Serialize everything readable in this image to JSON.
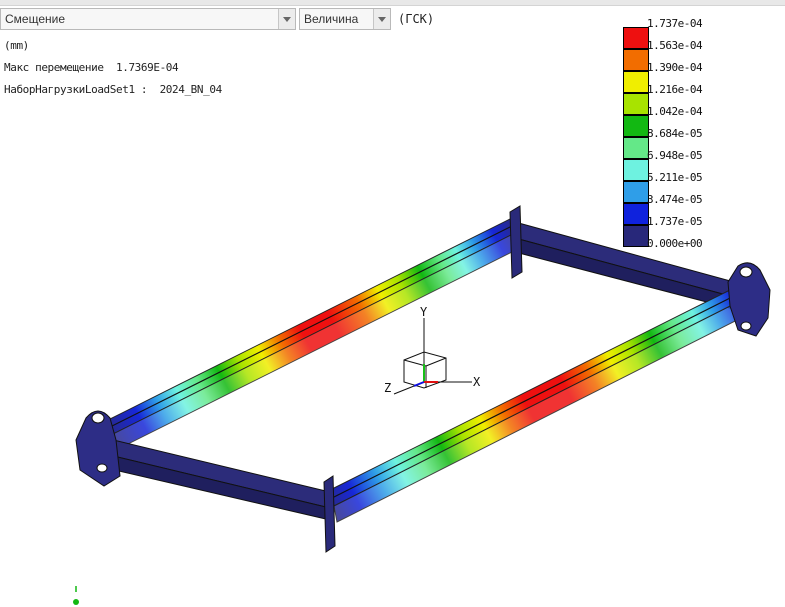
{
  "toolbar": {
    "result_type": "Смещение",
    "component": "Величина",
    "coord_system": "(ГСК)"
  },
  "info": {
    "units": "(mm)",
    "max_displacement": "Макс перемещение  1.7369E-04",
    "load_set": "НаборНагрузкиLoadSet1 :  2024_BN_04"
  },
  "legend": {
    "labels": [
      "1.737e-04",
      "1.563e-04",
      "1.390e-04",
      "1.216e-04",
      "1.042e-04",
      "8.684e-05",
      "6.948e-05",
      "5.211e-05",
      "3.474e-05",
      "1.737e-05",
      "0.000e+00"
    ],
    "colors": [
      "#ee1010",
      "#f26d00",
      "#f0ee00",
      "#a8e300",
      "#12b812",
      "#64e888",
      "#6ef2e0",
      "#2f9ee8",
      "#0f22dd",
      "#28287a"
    ]
  },
  "triad": {
    "x_label": "X",
    "y_label": "Y",
    "z_label": "Z"
  }
}
